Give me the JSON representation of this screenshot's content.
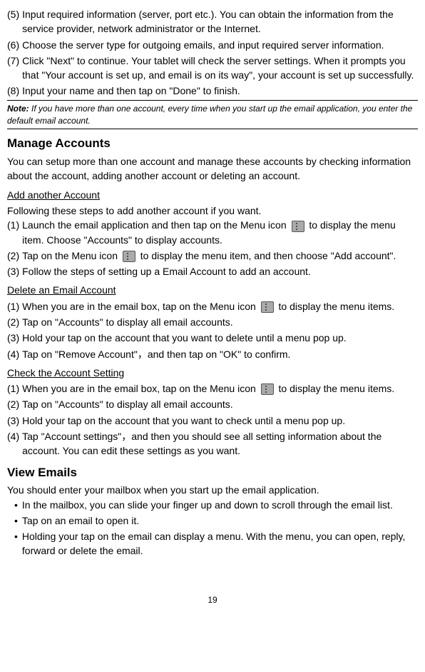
{
  "initial_steps": [
    {
      "num": "(5)",
      "text": "Input required information (server, port etc.). You can obtain the information from the service provider, network administrator or the Internet."
    },
    {
      "num": "(6)",
      "text": "Choose the server type for outgoing emails, and input required server information."
    },
    {
      "num": "(7)",
      "text": "Click \"Next\" to continue. Your tablet will check the server settings. When it prompts you that \"Your account is set up, and email is on its way\", your account is set up successfully."
    },
    {
      "num": "(8)",
      "text": "Input your name and then tap on \"Done\" to finish."
    }
  ],
  "note": {
    "label": "Note:",
    "text": " If you have more than one account, every time when you start up the email application, you enter the default email account."
  },
  "manage": {
    "heading": "Manage Accounts",
    "intro": "You can setup more than one account and manage these accounts by checking information about the account, adding another account or deleting an account."
  },
  "add_account": {
    "subheading": "Add another Account",
    "intro": "Following these steps to add another account if you want.",
    "step1_num": "(1)",
    "step1_before": "Launch the email application and then tap on the Menu icon ",
    "step1_after": " to display the menu item. Choose \"Accounts\" to display accounts.",
    "step2_num": "(2)",
    "step2_before": "Tap on the Menu icon ",
    "step2_after": " to display the menu item, and then choose \"Add account\".",
    "step3_num": "(3)",
    "step3_text": "Follow the steps of setting up a Email Account to add an account."
  },
  "delete_account": {
    "subheading": "Delete an Email Account",
    "step1_num": "(1)",
    "step1_before": "When you are in the email box, tap on the Menu icon ",
    "step1_after": " to display the menu items.",
    "steps_rest": [
      {
        "num": "(2)",
        "text": "Tap on \"Accounts\" to display all email accounts."
      },
      {
        "num": "(3)",
        "text": "Hold your tap on the account that you want to delete until a menu pop up."
      },
      {
        "num": "(4)",
        "text": "Tap on \"Remove Account\"，and then tap on \"OK\" to confirm."
      }
    ]
  },
  "check_account": {
    "subheading": "Check the Account Setting",
    "step1_num": "(1)",
    "step1_before": "When you are in the email box, tap on the Menu icon ",
    "step1_after": " to display the menu items.",
    "steps_rest": [
      {
        "num": "(2)",
        "text": "Tap on \"Accounts\" to display all email accounts."
      },
      {
        "num": "(3)",
        "text": "Hold your tap on the account that you want to check until a menu pop up."
      },
      {
        "num": "(4)",
        "text": "Tap \"Account settings\"，and then you should see all setting information about the account. You can edit these settings as you want."
      }
    ]
  },
  "view_emails": {
    "heading": "View Emails",
    "intro": "You should enter your mailbox when you start up the email application.",
    "bullets": [
      "In the mailbox, you can slide your finger up and down to scroll through the email list.",
      "Tap on an email to open it.",
      "Holding your tap on the email can display a menu. With the menu, you can open, reply, forward or delete the email."
    ]
  },
  "page_number": "19"
}
